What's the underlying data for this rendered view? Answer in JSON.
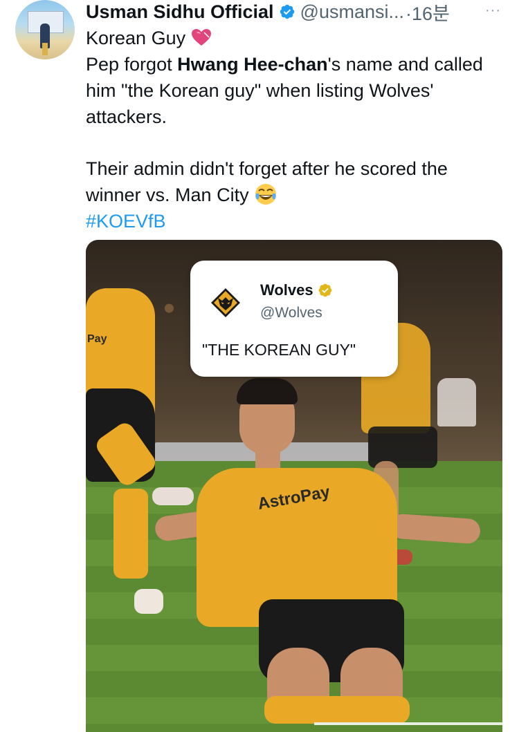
{
  "author": {
    "name": "Usman Sidhu Official",
    "handle": "@usmansi...",
    "time": "·16분",
    "more_label": "···"
  },
  "tweet": {
    "line1": "Korean Guy",
    "para1_pre": "Pep forgot ",
    "para1_bold": "Hwang Hee-chan",
    "para1_post": "'s name and called him \"the Korean guy\" when listing Wolves' attackers.",
    "para2": "Their admin didn't forget after he scored the winner vs. Man City",
    "hashtag": "#KOEVfB"
  },
  "media": {
    "quote_card": {
      "name": "Wolves",
      "handle": "@Wolves",
      "quote": "\"THE KOREAN GUY\""
    },
    "shirt_sponsor": "AstroPay",
    "side_sponsor": "Pay"
  },
  "colors": {
    "accent": "#1d9bf0",
    "verified": "#1d9bf0",
    "gold_badge": "#e2b719",
    "wolves_gold": "#e9a825"
  },
  "icons": [
    "verified-icon",
    "more-icon",
    "heart-emoji",
    "laughing-emoji",
    "wolves-logo",
    "gold-verified-icon"
  ]
}
